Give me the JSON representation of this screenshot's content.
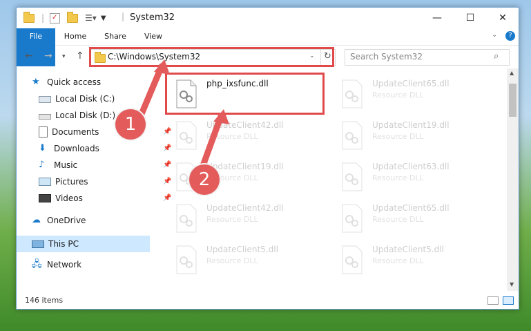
{
  "window": {
    "title": "System32",
    "controls": {
      "minimize": "—",
      "maximize": "☐",
      "close": "✕"
    }
  },
  "ribbon": {
    "tabs": [
      "File",
      "Home",
      "Share",
      "View"
    ]
  },
  "address": {
    "path": "C:\\Windows\\System32",
    "search_placeholder": "Search System32"
  },
  "sidebar": {
    "items": [
      {
        "label": "Quick access",
        "icon": "star-icon"
      },
      {
        "label": "Local Disk (C:)",
        "icon": "drive-icon"
      },
      {
        "label": "Local Disk (D:)",
        "icon": "drive-icon"
      },
      {
        "label": "Documents",
        "icon": "documents-icon"
      },
      {
        "label": "Downloads",
        "icon": "download-icon"
      },
      {
        "label": "Music",
        "icon": "music-icon"
      },
      {
        "label": "Pictures",
        "icon": "pictures-icon"
      },
      {
        "label": "Videos",
        "icon": "video-icon"
      },
      {
        "label": "OneDrive",
        "icon": "cloud-icon"
      },
      {
        "label": "This PC",
        "icon": "computer-icon"
      },
      {
        "label": "Network",
        "icon": "network-icon"
      }
    ],
    "selected": "This PC"
  },
  "files": [
    {
      "name": "php_ixsfunc.dll",
      "type": ""
    },
    {
      "name": "UpdateClient65.dll",
      "type": "Resource DLL"
    },
    {
      "name": "UpdateClient42.dll",
      "type": "Resource DLL"
    },
    {
      "name": "UpdateClient19.dll",
      "type": "Resource DLL"
    },
    {
      "name": "UpdateClient19.dll",
      "type": "Resource DLL"
    },
    {
      "name": "UpdateClient63.dll",
      "type": "Resource DLL"
    },
    {
      "name": "UpdateClient42.dll",
      "type": "Resource DLL"
    },
    {
      "name": "UpdateClient65.dll",
      "type": "Resource DLL"
    },
    {
      "name": "UpdateClient5.dll",
      "type": "Resource DLL"
    },
    {
      "name": "UpdateClient5.dll",
      "type": "Resource DLL"
    }
  ],
  "status": {
    "item_count": "146 items"
  },
  "annotations": {
    "step1": "1",
    "step2": "2",
    "color": "#e04a4a"
  }
}
